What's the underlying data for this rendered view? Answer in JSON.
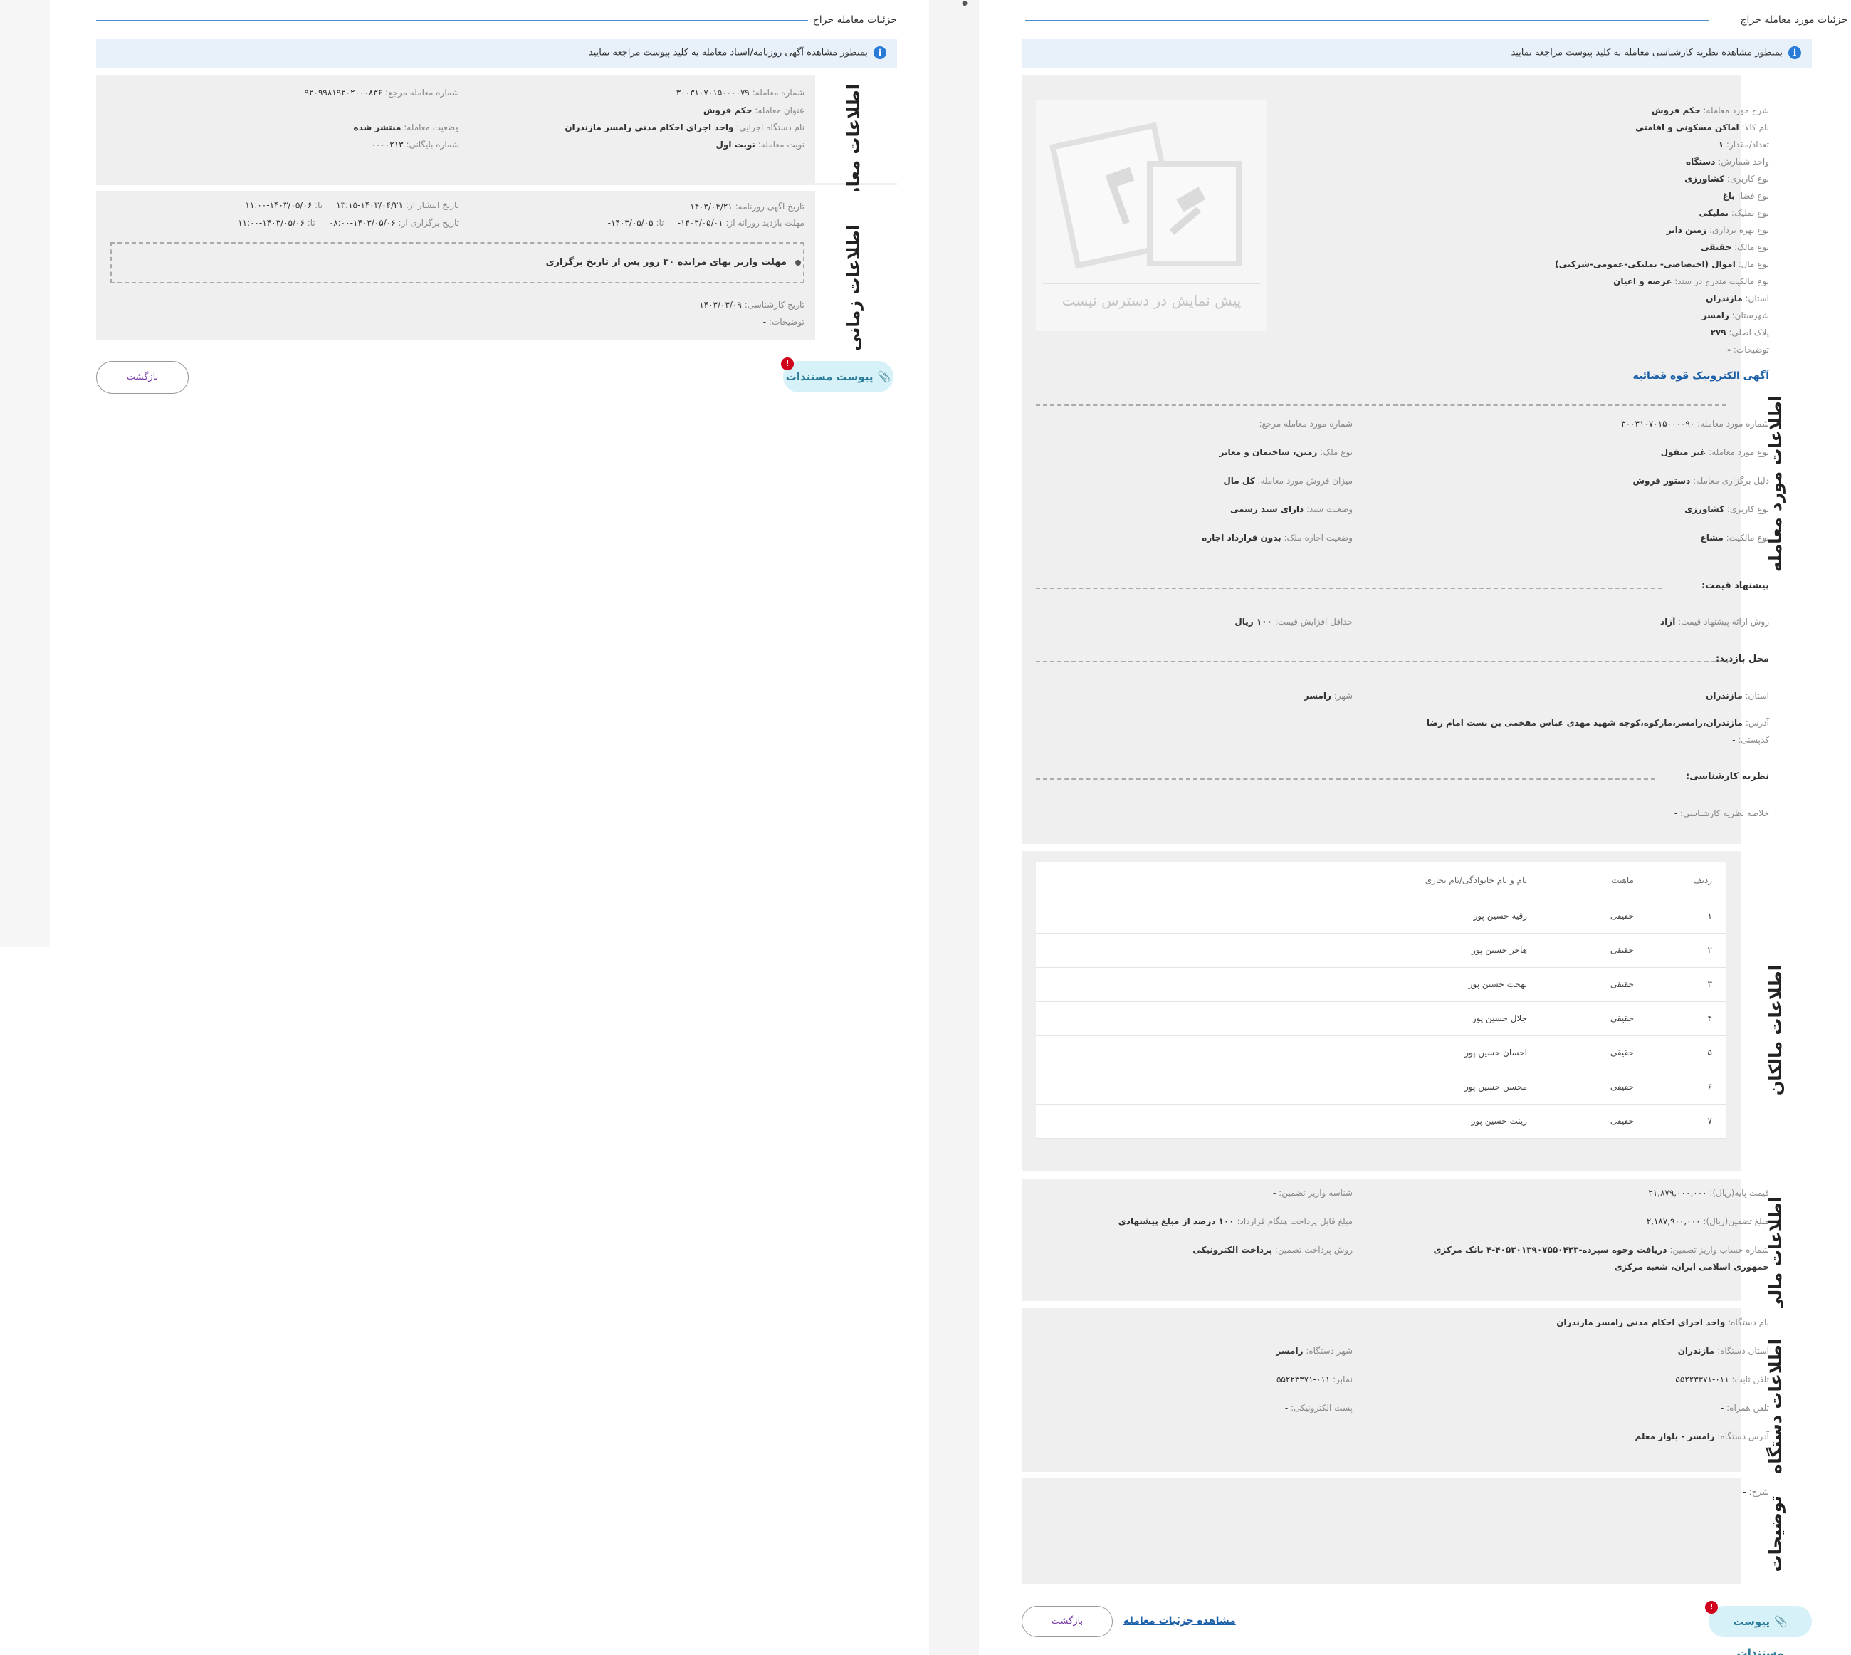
{
  "left": {
    "section_title": "جزئیات معامله حراج",
    "info_notice": "بمنظور مشاهده آگهی روزنامه/اسناد معامله به کلید پیوست مراجعه نمایید",
    "deal_info_title": "اطلاعات معامله",
    "deal_number_label": "شماره معامله:",
    "deal_number": "۳۰۰۳۱۰۷۰۱۵۰۰۰۰۷۹",
    "ref_number_label": "شماره معامله مرجع:",
    "ref_number": "۹۲۰۹۹۸۱۹۲۰۲۰۰۰۸۳۶",
    "deal_title_label": "عنوان معامله:",
    "deal_title": "حکم فروش",
    "executor_label": "نام دستگاه اجرایی:",
    "executor": "واحد اجرای احکام مدنی رامسر مازندران",
    "status_label": "وضعیت معامله:",
    "status": "منتشر شده",
    "round_label": "نوبت معامله:",
    "round": "نوبت اول",
    "archive_label": "شماره بایگانی:",
    "archive": "۰۰۰۰۲۱۳",
    "time_info_title": "اطلاعات زمانی",
    "ad_date_label": "تاریخ آگهی روزنامه:",
    "ad_date": "۱۴۰۳/۰۴/۲۱",
    "publish_label": "تاریخ انتشار از:",
    "publish_from": "۱۴۰۳/۰۴/۲۱-۱۳:۱۵",
    "publish_to_label": "تا:",
    "publish_to": "۱۴۰۳/۰۵/۰۶-۱۱:۰۰",
    "visit_label": "مهلت بازدید روزانه از:",
    "visit_from": "۱۴۰۳/۰۵/۰۱-",
    "visit_to_label": "تا:",
    "visit_to": "۱۴۰۳/۰۵/۰۵-",
    "hold_label": "تاریخ برگزاری از:",
    "hold_from": "۱۴۰۳/۰۵/۰۶-۰۸:۰۰",
    "hold_to_label": "تا:",
    "hold_to": "۱۴۰۳/۰۵/۰۶-۱۱:۰۰",
    "payment_note": "مهلت واریز بهای مزایده ۳۰ روز پس از تاریخ برگزاری",
    "expert_date_label": "تاریخ کارشناسی:",
    "expert_date": "۱۴۰۳/۰۳/۰۹",
    "desc_label": "توضیحات:",
    "desc": "-",
    "attach_button": "پیوست مستندات",
    "attach_badge": "!",
    "back_button": "بازگشت"
  },
  "right": {
    "section_title": "جزئیات مورد معامله حراج",
    "info_notice": "بمنظور مشاهده نظریه کارشناسی معامله به کلید پیوست مراجعه نمایید",
    "item_info_title": "اطلاعات مورد معامله",
    "preview_text": "پیش نمایش در دسترس نیست",
    "details": [
      {
        "label": "شرح مورد معامله:",
        "value": "حکم فروش"
      },
      {
        "label": "نام کالا:",
        "value": "اماکن مسکونی و اقامتی"
      },
      {
        "label": "تعداد/مقدار:",
        "value": "۱"
      },
      {
        "label": "واحد شمارش:",
        "value": "دستگاه"
      },
      {
        "label": "نوع کاربری:",
        "value": "کشاورزی"
      },
      {
        "label": "نوع فضا:",
        "value": "باغ"
      },
      {
        "label": "نوع تملیک:",
        "value": "تملیکی"
      },
      {
        "label": "نوع بهره برداری:",
        "value": "زمین دایر"
      },
      {
        "label": "نوع مالک:",
        "value": "حقیقی"
      },
      {
        "label": "نوع مال:",
        "value": "اموال (اختصاصی- تملیکی-عمومی-شرکتی)"
      },
      {
        "label": "نوع مالکیت مندرج در سند:",
        "value": "عرصه و اعیان"
      },
      {
        "label": "استان:",
        "value": "مازندران"
      },
      {
        "label": "شهرستان:",
        "value": "رامسر"
      },
      {
        "label": "پلاک اصلی:",
        "value": "۲۷۹"
      },
      {
        "label": "توضیحات:",
        "value": "-"
      }
    ],
    "ad_link": "آگهی الکترونیک قوه قضائیه",
    "item_number_label": "شماره مورد معامله:",
    "item_number": "۳۰۰۳۱۰۷۰۱۵۰۰۰۰۹۰",
    "item_ref_label": "شماره مورد معامله مرجع:",
    "item_ref": "-",
    "item_type_label": "نوع مورد معامله:",
    "item_type": "غیر منقول",
    "property_type_label": "نوع ملک:",
    "property_type": "زمین، ساختمان و معابر",
    "reason_label": "دلیل برگزاری معامله:",
    "reason": "دستور فروش",
    "sale_amount_label": "میزان فروش مورد معامله:",
    "sale_amount": "کل مال",
    "usage_label": "نوع کاربری:",
    "usage": "کشاورزی",
    "deed_label": "وضعیت سند:",
    "deed": "دارای سند رسمی",
    "ownership_label": "نوع مالکیت:",
    "ownership": "مشاع",
    "lease_label": "وضعیت اجاره ملک:",
    "lease": "بدون قرارداد اجاره",
    "offer_title": "پیشنهاد قیمت:",
    "offer_method_label": "روش ارائه پیشنهاد قیمت:",
    "offer_method": "آزاد",
    "min_increase_label": "حداقل افزایش قیمت:",
    "min_increase": "۱۰۰ ریال",
    "visit_title": "محل بازدید:",
    "visit_province_label": "استان:",
    "visit_province": "مازندران",
    "visit_city_label": "شهر:",
    "visit_city": "رامسر",
    "address_label": "آدرس:",
    "address": "مازندران،رامسر،مارکوه،کوچه شهید مهدی عباس مفخمی بن بست امام رضا",
    "postal_label": "کدپستی:",
    "postal": "-",
    "expert_title": "نظریه کارشناسی:",
    "expert_summary_label": "خلاصه نظریه کارشناسی:",
    "expert_summary": "-",
    "owners_title": "اطلاعات مالکان",
    "owners_headers": {
      "row": "ردیف",
      "type": "ماهیت",
      "name": "نام و نام خانوادگی/نام تجاری"
    },
    "owners": [
      {
        "row": "۱",
        "type": "حقیقی",
        "name": "رقیه حسین پور"
      },
      {
        "row": "۲",
        "type": "حقیقی",
        "name": "هاجر حسین پور"
      },
      {
        "row": "۳",
        "type": "حقیقی",
        "name": "بهجت حسین پور"
      },
      {
        "row": "۴",
        "type": "حقیقی",
        "name": "جلال حسین پور"
      },
      {
        "row": "۵",
        "type": "حقیقی",
        "name": "احسان حسین پور"
      },
      {
        "row": "۶",
        "type": "حقیقی",
        "name": "محسن حسین پور"
      },
      {
        "row": "۷",
        "type": "حقیقی",
        "name": "زینت حسین پور"
      }
    ],
    "finance_title": "اطلاعات مالی",
    "base_price_label": "قیمت پایه(ریال):",
    "base_price": "۲۱,۸۷۹,۰۰۰,۰۰۰",
    "deposit_id_label": "شناسه واریز تضمین:",
    "deposit_id": "-",
    "guarantee_label": "مبلغ تضمین(ریال):",
    "guarantee": "۲,۱۸۷,۹۰۰,۰۰۰",
    "payable_label": "مبلغ قابل پرداخت هنگام قرارداد:",
    "payable": "۱۰۰ درصد از مبلغ پیشنهادی",
    "account_label": "شماره حساب واریز تضمین:",
    "account_line1": "دریافت وجوه سپرده-۴۰۵۳۰۱۳۹۰۷۵۵۰۴۲۳-۴ بانک مرکزی",
    "account_line2": "جمهوری اسلامی ایران، شعبه مرکزی",
    "pay_method_label": "روش پرداخت تضمین:",
    "pay_method": "پرداخت الکترونیکی",
    "org_title": "اطلاعات دستگاه",
    "org_name_label": "نام دستگاه:",
    "org_name": "واحد اجرای احکام مدنی رامسر مازندران",
    "org_province_label": "استان دستگاه:",
    "org_province": "مازندران",
    "org_city_label": "شهر دستگاه:",
    "org_city": "رامسر",
    "phone_label": "تلفن ثابت:",
    "phone": "۰۱۱-۵۵۲۲۳۳۷۱",
    "fax_label": "نمابر:",
    "fax": "۰۱۱-۵۵۲۲۳۳۷۱",
    "mobile_label": "تلفن همراه:",
    "mobile": "-",
    "email_label": "پست الکترونیکی:",
    "email": "-",
    "org_address_label": "آدرس دستگاه:",
    "org_address": "رامسر - بلوار معلم",
    "notes_title": "توضیحات",
    "notes_label": "شرح:",
    "notes": "-",
    "attach_button": "پیوست مستندات",
    "attach_badge": "!",
    "details_link": "مشاهده جزئیات معامله",
    "back_button": "بازگشت"
  },
  "colors": {
    "accent": "#4a8cc7",
    "panel": "#efefef",
    "notice": "#e8f1fa",
    "attach": "#d6f1f7",
    "badge": "#d0021b",
    "link": "#1a5fa8"
  }
}
